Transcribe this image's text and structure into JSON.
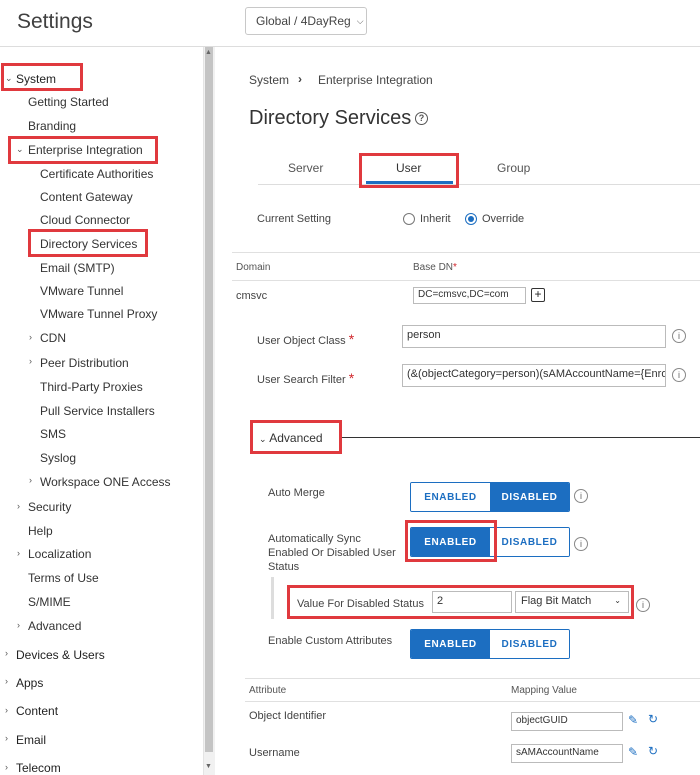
{
  "app": {
    "title": "Settings"
  },
  "org_selector": {
    "value": "Global / 4DayReg"
  },
  "sidebar": {
    "system": "System",
    "getting_started": "Getting Started",
    "branding": "Branding",
    "enterprise_integration": "Enterprise Integration",
    "certificate_authorities": "Certificate Authorities",
    "content_gateway": "Content Gateway",
    "cloud_connector": "Cloud Connector",
    "directory_services": "Directory Services",
    "email_smtp": "Email (SMTP)",
    "vmware_tunnel": "VMware Tunnel",
    "vmware_tunnel_proxy": "VMware Tunnel Proxy",
    "cdn": "CDN",
    "peer_distribution": "Peer Distribution",
    "third_party_proxies": "Third-Party Proxies",
    "pull_service_installers": "Pull Service Installers",
    "sms": "SMS",
    "syslog": "Syslog",
    "workspace_one_access": "Workspace ONE Access",
    "security": "Security",
    "help": "Help",
    "localization": "Localization",
    "terms_of_use": "Terms of Use",
    "smime": "S/MIME",
    "advanced": "Advanced",
    "devices_users": "Devices & Users",
    "apps": "Apps",
    "content": "Content",
    "email": "Email",
    "telecom": "Telecom"
  },
  "breadcrumb": {
    "root": "System",
    "current": "Enterprise Integration"
  },
  "page": {
    "title": "Directory Services"
  },
  "tabs": {
    "server": "Server",
    "user": "User",
    "group": "Group",
    "active": "User"
  },
  "current_setting": {
    "label": "Current Setting",
    "inherit": "Inherit",
    "override": "Override",
    "selected": "Override"
  },
  "domain_table": {
    "domain_header": "Domain",
    "base_dn_header": "Base DN",
    "domain_value": "cmsvc",
    "base_dn_value": "DC=cmsvc,DC=com"
  },
  "user_object_class": {
    "label": "User Object Class",
    "value": "person"
  },
  "user_search_filter": {
    "label": "User Search Filter",
    "value": "(&(objectCategory=person)(sAMAccountName={EnrollmentUser}))"
  },
  "advanced_section": {
    "label": "Advanced"
  },
  "auto_merge": {
    "label": "Auto Merge",
    "enabled": "ENABLED",
    "disabled": "DISABLED",
    "selected": "DISABLED"
  },
  "auto_sync": {
    "label": "Automatically Sync Enabled Or Disabled User Status",
    "enabled": "ENABLED",
    "disabled": "DISABLED",
    "selected": "ENABLED"
  },
  "disabled_status": {
    "label": "Value For Disabled Status",
    "value": "2",
    "match_option": "Flag Bit Match"
  },
  "custom_attributes": {
    "label": "Enable Custom Attributes",
    "enabled": "ENABLED",
    "disabled": "DISABLED",
    "selected": "ENABLED"
  },
  "attribute_table": {
    "attribute_header": "Attribute",
    "mapping_header": "Mapping Value",
    "rows": [
      {
        "attribute": "Object Identifier",
        "value": "objectGUID"
      },
      {
        "attribute": "Username",
        "value": "sAMAccountName"
      }
    ]
  },
  "colors": {
    "accent": "#1c6ec1",
    "highlight": "#e0393e",
    "required": "#d0252b"
  }
}
